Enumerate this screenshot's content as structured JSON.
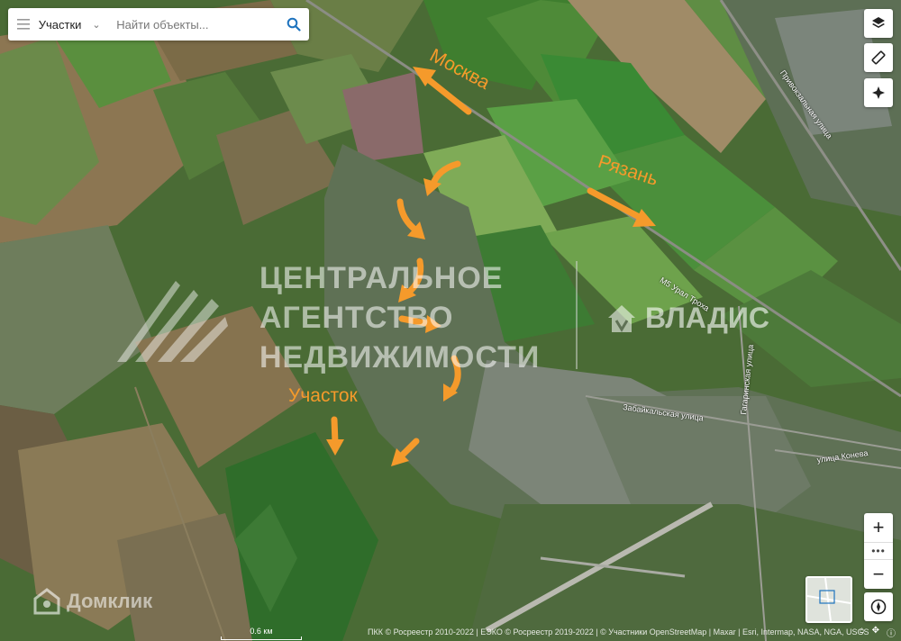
{
  "search": {
    "category": "Участки",
    "placeholder": "Найти объекты..."
  },
  "map_labels": {
    "moscow": "Москва",
    "ryazan": "Рязань",
    "plot": "Участок"
  },
  "roads": {
    "zabaikalskaya": "Забайкальская улица",
    "konev": "улица Конева",
    "ural": "М5 Урал Троха",
    "gagarina": "Гагаринская улица",
    "privokzalnaya": "Привокзальная улица"
  },
  "watermarks": {
    "agency_lines": [
      "ЦЕНТРАЛЬНОЕ",
      "АГЕНТСТВО",
      "НЕДВИЖИМОСТИ"
    ],
    "vladis": "ВЛАДИС",
    "domklik": "Домклик"
  },
  "scale": {
    "label": "0.6 км"
  },
  "attribution": "ПКК © Росреестр 2010-2022 | ЕЭКО © Росреестр 2019-2022 | © Участники OpenStreetMap | Maxar | Esri, Intermap, NASA, NGA, USGS",
  "controls": {
    "layers": "layers-icon",
    "ruler": "ruler-icon",
    "locate": "locate-icon",
    "zoom_in": "+",
    "zoom_more": "•••",
    "zoom_out": "−",
    "compass": "compass-icon"
  },
  "colors": {
    "arrow": "#f59a2b",
    "accent": "#1e73be"
  }
}
